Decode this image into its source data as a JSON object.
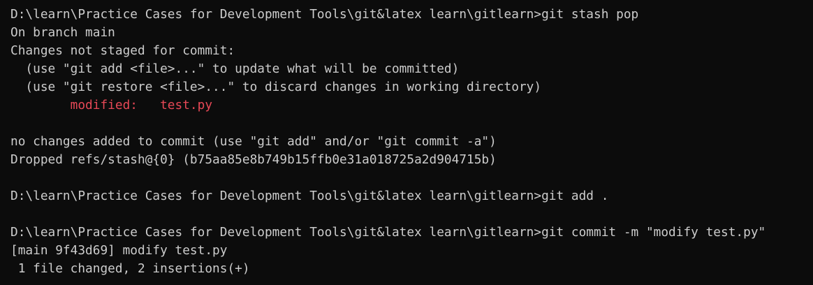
{
  "terminal": {
    "lines": [
      {
        "text": "D:\\learn\\Practice Cases for Development Tools\\git&latex learn\\gitlearn>git stash pop"
      },
      {
        "text": "On branch main"
      },
      {
        "text": "Changes not staged for commit:"
      },
      {
        "text": "  (use \"git add <file>...\" to update what will be committed)"
      },
      {
        "text": "  (use \"git restore <file>...\" to discard changes in working directory)"
      },
      {
        "text": "        modified:   test.py",
        "color": "#e74856"
      },
      {
        "text": ""
      },
      {
        "text": "no changes added to commit (use \"git add\" and/or \"git commit -a\")"
      },
      {
        "text": "Dropped refs/stash@{0} (b75aa85e8b749b15ffb0e31a018725a2d904715b)"
      },
      {
        "text": ""
      },
      {
        "text": "D:\\learn\\Practice Cases for Development Tools\\git&latex learn\\gitlearn>git add ."
      },
      {
        "text": ""
      },
      {
        "text": "D:\\learn\\Practice Cases for Development Tools\\git&latex learn\\gitlearn>git commit -m \"modify test.py\""
      },
      {
        "text": "[main 9f43d69] modify test.py"
      },
      {
        "text": " 1 file changed, 2 insertions(+)"
      }
    ]
  },
  "colors": {
    "background": "#0c0c0c",
    "foreground": "#cccccc",
    "modified": "#e74856"
  }
}
